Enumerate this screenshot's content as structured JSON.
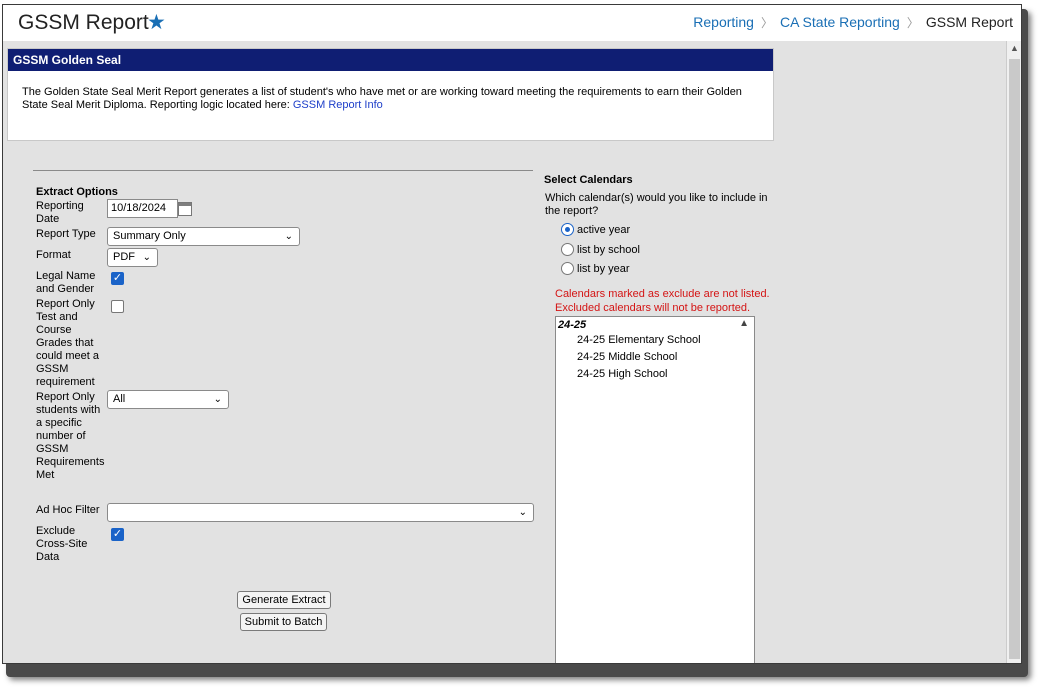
{
  "header": {
    "title": "GSSM Report",
    "breadcrumb": [
      "Reporting",
      "CA State Reporting",
      "GSSM Report"
    ]
  },
  "seal": {
    "title": "GSSM Golden Seal",
    "description": "The Golden State Seal Merit Report generates a list of student's who have met or are working toward meeting the requirements to earn their Golden State Seal Merit Diploma. Reporting logic located here:",
    "link_label": "GSSM Report Info"
  },
  "extract": {
    "section_title": "Extract Options",
    "reporting_date_label": "Reporting Date",
    "reporting_date_value": "10/18/2024",
    "report_type_label": "Report Type",
    "report_type_value": "Summary Only",
    "format_label": "Format",
    "format_value": "PDF",
    "legal_name_label": "Legal Name and Gender",
    "legal_name_checked": true,
    "report_only_test_label": "Report Only Test and Course Grades that could meet a GSSM requirement",
    "report_only_test_checked": false,
    "report_only_students_label": "Report Only students with a specific number of GSSM Requirements Met",
    "report_only_students_value": "All",
    "adhoc_label": "Ad Hoc Filter",
    "adhoc_value": "",
    "exclude_label": "Exclude Cross-Site Data",
    "exclude_checked": true,
    "generate_button": "Generate Extract",
    "batch_button": "Submit to Batch"
  },
  "calendars": {
    "title": "Select Calendars",
    "question": "Which calendar(s) would you like to include in the report?",
    "options": [
      "active year",
      "list by school",
      "list by year"
    ],
    "selected": "active year",
    "warning_1": "Calendars marked as exclude are not listed.",
    "warning_2": "Excluded calendars will not be reported.",
    "group": "24-25",
    "items": [
      "24-25 Elementary School",
      "24-25 Middle School",
      "24-25 High School"
    ]
  },
  "colors": {
    "accent": "#1a6fb5",
    "panel_header": "#0f1e73",
    "warning": "#d41414",
    "checkbox": "#1a63c8"
  }
}
